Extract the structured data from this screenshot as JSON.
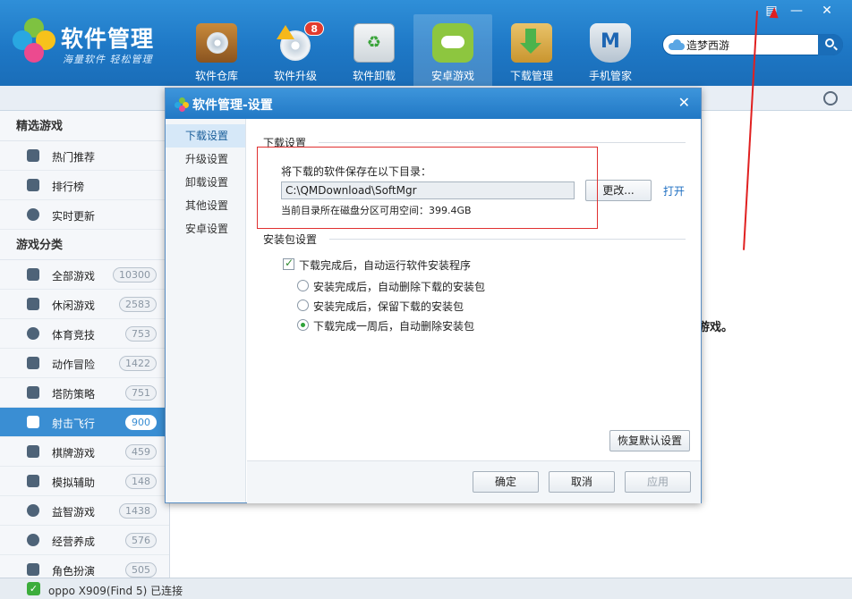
{
  "app": {
    "title": "软件管理",
    "slogan": "海量软件 轻松管理"
  },
  "nav": {
    "items": [
      {
        "label": "软件仓库",
        "icon": "disc-box-icon"
      },
      {
        "label": "软件升级",
        "icon": "upgrade-disc-icon",
        "badge": "8"
      },
      {
        "label": "软件卸载",
        "icon": "recycle-bin-icon"
      },
      {
        "label": "安卓游戏",
        "icon": "android-gamepad-icon",
        "active": true
      },
      {
        "label": "下载管理",
        "icon": "download-folder-icon"
      },
      {
        "label": "手机管家",
        "icon": "shield-m-icon"
      }
    ]
  },
  "search": {
    "value": "造梦西游"
  },
  "window": {
    "menu": "▤",
    "minimize": "—",
    "close": "✕"
  },
  "sidebar": {
    "section1": "精选游戏",
    "featured": [
      {
        "label": "热门推荐",
        "icon": "thumbs-up-icon"
      },
      {
        "label": "排行榜",
        "icon": "trophy-icon"
      },
      {
        "label": "实时更新",
        "icon": "clock-icon"
      }
    ],
    "section2": "游戏分类",
    "categories": [
      {
        "label": "全部游戏",
        "count": "10300",
        "icon": "grid-icon"
      },
      {
        "label": "休闲游戏",
        "count": "2583",
        "icon": "cup-icon"
      },
      {
        "label": "体育竞技",
        "count": "753",
        "icon": "ball-icon"
      },
      {
        "label": "动作冒险",
        "count": "1422",
        "icon": "runner-icon"
      },
      {
        "label": "塔防策略",
        "count": "751",
        "icon": "tower-icon"
      },
      {
        "label": "射击飞行",
        "count": "900",
        "icon": "plane-icon",
        "active": true
      },
      {
        "label": "棋牌游戏",
        "count": "459",
        "icon": "chess-icon"
      },
      {
        "label": "模拟辅助",
        "count": "148",
        "icon": "wrench-icon"
      },
      {
        "label": "益智游戏",
        "count": "1438",
        "icon": "bulb-icon"
      },
      {
        "label": "经营养成",
        "count": "576",
        "icon": "pie-icon"
      },
      {
        "label": "角色扮演",
        "count": "505",
        "icon": "person-icon"
      }
    ]
  },
  "main": {
    "partial_text": "游戏。"
  },
  "status": {
    "text": "oppo X909(Find 5) 已连接"
  },
  "dialog": {
    "title": "软件管理-设置",
    "close": "✕",
    "nav": [
      "下载设置",
      "升级设置",
      "卸载设置",
      "其他设置",
      "安卓设置"
    ],
    "download_section": "下载设置",
    "save_to_label": "将下载的软件保存在以下目录：",
    "path": "C:\\QMDownload\\SoftMgr",
    "change_btn": "更改...",
    "open_link": "打开",
    "free_space": "当前目录所在磁盘分区可用空间：399.4GB",
    "install_section": "安装包设置",
    "auto_install": "下载完成后，自动运行软件安装程序",
    "options": [
      {
        "label": "安装完成后，自动删除下载的安装包",
        "selected": false
      },
      {
        "label": "安装完成后，保留下载的安装包",
        "selected": false
      },
      {
        "label": "下载完成一周后，自动删除安装包",
        "selected": true
      }
    ],
    "restore_btn": "恢复默认设置",
    "ok_btn": "确定",
    "cancel_btn": "取消",
    "apply_btn": "应用"
  }
}
